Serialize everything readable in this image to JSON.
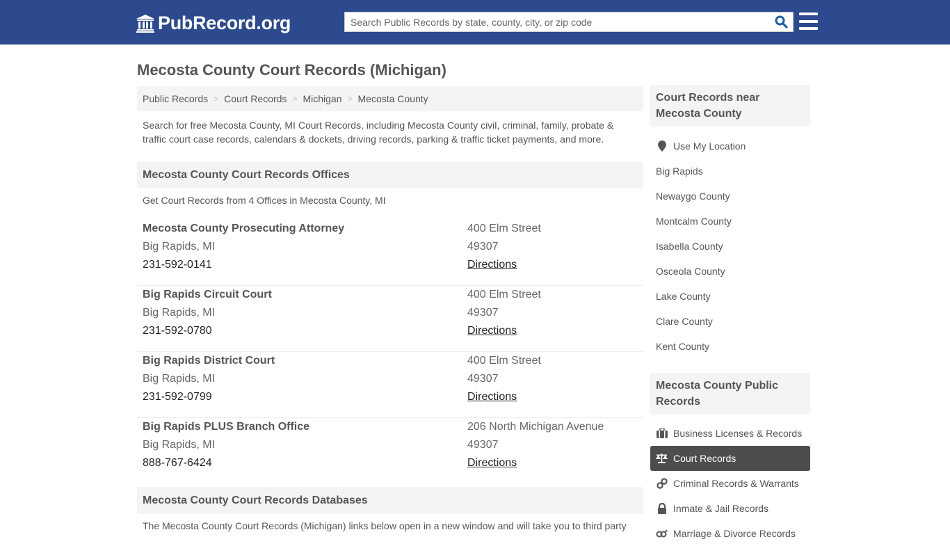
{
  "header": {
    "logo_text": "PubRecord.org",
    "logo_icon": "courthouse-icon",
    "search_placeholder": "Search Public Records by state, county, city, or zip code",
    "search_icon": "search-icon",
    "menu_icon": "hamburger-menu-icon",
    "brand_color": "#2d4a8e",
    "search_icon_color": "#1f5fa8"
  },
  "page": {
    "title": "Mecosta County Court Records (Michigan)",
    "breadcrumb": [
      "Public Records",
      "Court Records",
      "Michigan",
      "Mecosta County"
    ],
    "breadcrumb_separator": ">",
    "intro": "Search for free Mecosta County, MI Court Records, including Mecosta County civil, criminal, family, probate & traffic court case records, calendars & dockets, driving records, parking & traffic ticket payments, and more."
  },
  "offices": {
    "heading": "Mecosta County Court Records Offices",
    "subtitle": "Get Court Records from 4 Offices in Mecosta County, MI",
    "items": [
      {
        "name": "Mecosta County Prosecuting Attorney",
        "city": "Big Rapids, MI",
        "phone": "231-592-0141",
        "address": "400 Elm Street",
        "zip": "49307",
        "directions": "Directions"
      },
      {
        "name": "Big Rapids Circuit Court",
        "city": "Big Rapids, MI",
        "phone": "231-592-0780",
        "address": "400 Elm Street",
        "zip": "49307",
        "directions": "Directions"
      },
      {
        "name": "Big Rapids District Court",
        "city": "Big Rapids, MI",
        "phone": "231-592-0799",
        "address": "400 Elm Street",
        "zip": "49307",
        "directions": "Directions"
      },
      {
        "name": "Big Rapids PLUS Branch Office",
        "city": "Big Rapids, MI",
        "phone": "888-767-6424",
        "address": "206 North Michigan Avenue",
        "zip": "49307",
        "directions": "Directions"
      }
    ]
  },
  "databases": {
    "heading": "Mecosta County Court Records Databases",
    "text": "The Mecosta County Court Records (Michigan) links below open in a new window and will take you to third party"
  },
  "sidebar": {
    "nearby": {
      "heading": "Court Records near Mecosta County",
      "use_location": "Use My Location",
      "items": [
        "Big Rapids",
        "Newaygo County",
        "Montcalm County",
        "Isabella County",
        "Osceola County",
        "Lake County",
        "Clare County",
        "Kent County"
      ]
    },
    "public_records": {
      "heading": "Mecosta County Public Records",
      "items": [
        {
          "label": "Business Licenses & Records",
          "icon": "briefcase-icon",
          "active": false
        },
        {
          "label": "Court Records",
          "icon": "scales-icon",
          "active": true
        },
        {
          "label": "Criminal Records & Warrants",
          "icon": "handcuffs-icon",
          "active": false
        },
        {
          "label": "Inmate & Jail Records",
          "icon": "lock-icon",
          "active": false
        },
        {
          "label": "Marriage & Divorce Records",
          "icon": "gender-icon",
          "active": false
        }
      ]
    }
  }
}
